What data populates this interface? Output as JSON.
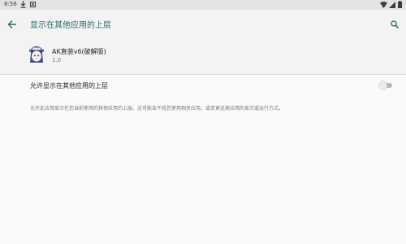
{
  "status_bar": {
    "time": "8:56",
    "icons": [
      "download-icon",
      "notification-icon",
      "wifi-icon",
      "signal-icon",
      "battery-icon"
    ]
  },
  "app_bar": {
    "title": "显示在其他应用的上层",
    "back_icon": "back-arrow-icon",
    "search_icon": "search-icon"
  },
  "app_info": {
    "name": "AK直装v6(破解版)",
    "version": "1.0"
  },
  "permission": {
    "toggle_label": "允许显示在其他应用的上层",
    "enabled": false,
    "description": "允许此应用显示在您当前使用的其他应用的上层。这可能会干扰您使用相关应用，或变更这类应用的显示或运行方式。"
  },
  "colors": {
    "accent": "#1f6d66",
    "background": "#f3f3f3",
    "content_background": "#fafafa"
  }
}
